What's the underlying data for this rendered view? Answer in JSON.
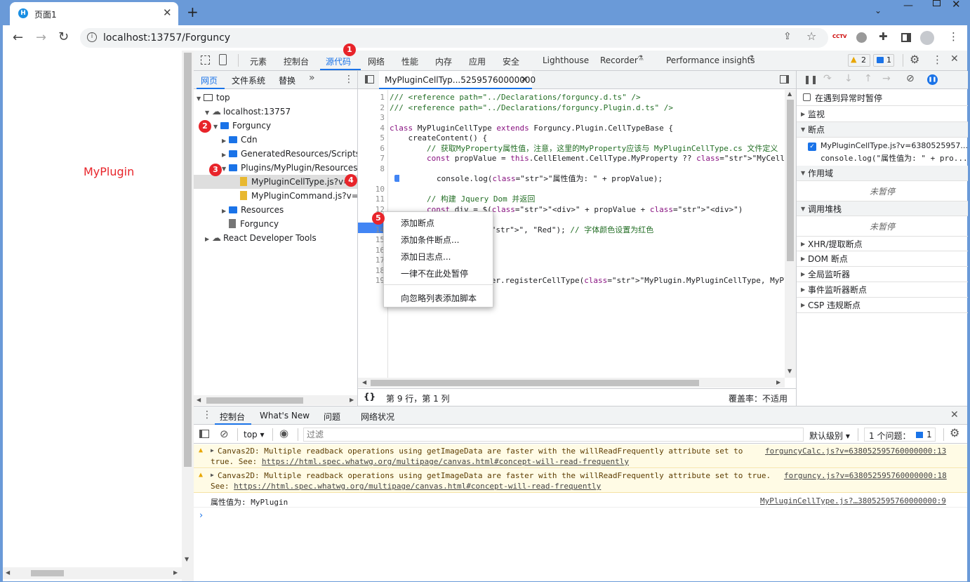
{
  "browser": {
    "tab_title": "页面1",
    "url": "localhost:13757/Forguncy"
  },
  "page": {
    "plugin_label": "MyPlugin"
  },
  "devtools": {
    "tabs": [
      "元素",
      "控制台",
      "源代码",
      "网络",
      "性能",
      "内存",
      "应用",
      "安全",
      "Lighthouse",
      "Recorder",
      "Performance insights"
    ],
    "warn_count": "2",
    "info_count": "1",
    "nav_tabs": [
      "网页",
      "文件系统",
      "替换"
    ],
    "tree": {
      "top": "top",
      "host": "localhost:13757",
      "forguncy": "Forguncy",
      "cdn": "Cdn",
      "generated": "GeneratedResources/Scripts/Fo",
      "plugins": "Plugins/MyPlugin/Resources",
      "file1": "MyPluginCellType.js?v=6",
      "file2": "MyPluginCommand.js?v=63",
      "resources": "Resources",
      "forguncy_file": "Forguncy",
      "react": "React Developer Tools"
    },
    "editor_tab": "MyPluginCellTyp...52595760000000",
    "code_lines": [
      {
        "n": "1",
        "t": "/// <reference path=\"../Declarations/forguncy.d.ts\" />"
      },
      {
        "n": "2",
        "t": "/// <reference path=\"../Declarations/forguncy.Plugin.d.ts\" />"
      },
      {
        "n": "3",
        "t": ""
      },
      {
        "n": "4",
        "t": "class MyPluginCellType extends Forguncy.Plugin.CellTypeBase {"
      },
      {
        "n": "5",
        "t": "    createContent() {"
      },
      {
        "n": "6",
        "t": "        // 获取MyProperty属性值，注意，这里的MyProperty应该与 MyPluginCellType.cs 文件定义"
      },
      {
        "n": "7",
        "t": "        const propValue = this.CellElement.CellType.MyProperty ?? \"MyCell\";"
      },
      {
        "n": "8",
        "t": ""
      },
      {
        "n": "9",
        "t": "        console.log(\"属性值为: \" + propValue);"
      },
      {
        "n": "10",
        "t": ""
      },
      {
        "n": "11",
        "t": "        // 构建 Jquery Dom 并返回"
      },
      {
        "n": "12",
        "t": "        const div = $(\"<div>\" + propValue + \"<div>\")"
      },
      {
        "n": "13",
        "t": ""
      },
      {
        "n": "14",
        "t": "\", \"Red\"); // 字体颜色设置为红色"
      },
      {
        "n": "15",
        "t": ""
      },
      {
        "n": "16",
        "t": ""
      },
      {
        "n": "17",
        "t": ""
      },
      {
        "n": "18",
        "t": ""
      },
      {
        "n": "19",
        "t": "peHelper.registerCellType(\"MyPlugin.MyPluginCellType, MyPlugin\""
      }
    ],
    "status_pos": "第 9 行，第 1 列",
    "coverage": "覆盖率：不适用",
    "debugger": {
      "pause_exceptions": "在遇到异常时暂停",
      "watch": "监视",
      "breakpoints": "断点",
      "bp_file": "MyPluginCellType.js?v=6380525957...",
      "bp_code": "console.log(\"属性值为: \" + pro...",
      "scope": "作用域",
      "not_paused": "未暂停",
      "callstack": "调用堆栈",
      "not_paused2": "未暂停",
      "xhr": "XHR/提取断点",
      "dom": "DOM 断点",
      "global": "全局监听器",
      "event": "事件监听器断点",
      "csp": "CSP 违规断点"
    },
    "context_menu": [
      "添加断点",
      "添加条件断点...",
      "添加日志点...",
      "一律不在此处暂停",
      "向忽略列表添加脚本"
    ],
    "console": {
      "tabs": [
        "控制台",
        "What's New",
        "问题",
        "网络状况"
      ],
      "context": "top",
      "filter_placeholder": "过滤",
      "level": "默认级别",
      "issues": "1 个问题：",
      "issues_count": "1",
      "msg1_text": "Canvas2D: Multiple readback operations using getImageData are faster with the willReadFrequently attribute set to",
      "msg1_text2": "true. See: ",
      "msg1_link": "https://html.spec.whatwg.org/multipage/canvas.html#concept-will-read-frequently",
      "msg1_src": "forguncyCalc.js?v=638052595760000000:13",
      "msg2_text": "Canvas2D: Multiple readback operations using getImageData are faster with the willReadFrequently attribute set to true.",
      "msg2_text2": "See: ",
      "msg2_link": "https://html.spec.whatwg.org/multipage/canvas.html#concept-will-read-frequently",
      "msg2_src": "forguncy.js?v=638052595760000000:18",
      "log_text": "属性值为: MyPlugin",
      "log_src": "MyPluginCellType.js?…38052595760000000:9"
    }
  },
  "badges": [
    "1",
    "2",
    "3",
    "4",
    "5"
  ]
}
